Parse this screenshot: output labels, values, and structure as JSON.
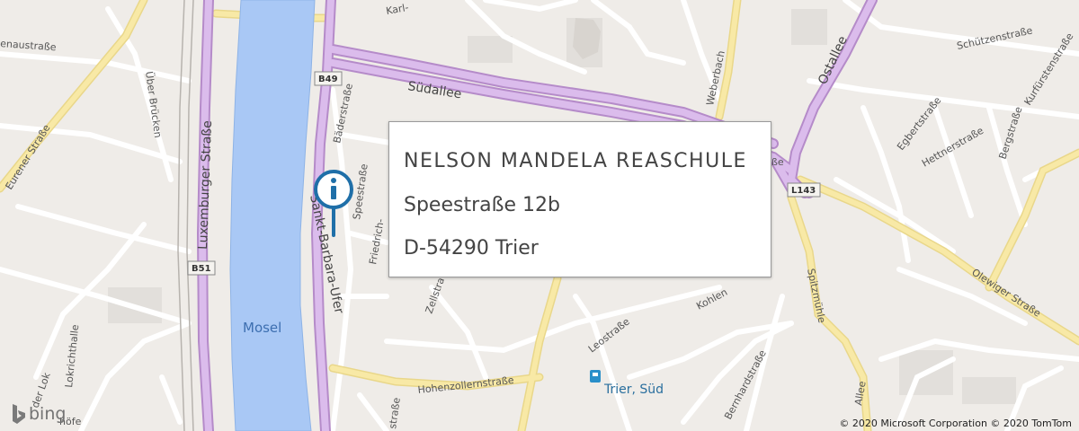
{
  "map": {
    "river_label": "Mosel",
    "street_labels": {
      "suedallee": "Südallee",
      "ostallee": "Ostallee",
      "luxemburger": "Luxemburger Straße",
      "sankt_barbara": "Sankt-Barbara-Ufer",
      "eurener": "Eurener Straße",
      "weberbach": "Weberbach",
      "olewiger": "Olewiger Straße",
      "hohenzollern": "Hohenzollernstraße",
      "leostrasse": "Leostraße",
      "bernhard": "Bernhardstraße",
      "schuetzen": "Schützenstraße",
      "egbert": "Egbertstraße",
      "hettner": "Hettnerstraße",
      "berg": "Bergstraße",
      "kurfuersten": "Kurfürstenstraße",
      "baeder": "Bäderstraße",
      "speestrasse": "Speestraße",
      "friedrich": "Friedrich-",
      "zell": "Zellstra",
      "spitzmuehle": "Spitzmühle",
      "kohlen": "Kohlen",
      "uber_bruecken": "Über Brücken",
      "lokrichthalle": "Lokrichthalle",
      "der_lok": "der Lok",
      "hoefe": "höfe",
      "enaustrasse": "enaustraße",
      "karl": "Karl-",
      "allee": "Allee",
      "strasse_frag": "straße",
      "be_frag": "ße"
    },
    "shields": {
      "b49": "B49",
      "b51": "B51",
      "l143": "L143"
    },
    "station_label": "Trier, Süd",
    "pin_icon": "info-pin-icon",
    "colors": {
      "land": "#efece8",
      "water": "#a9c8f5",
      "highway": "#d9b4e8",
      "highway_edge": "#b58bc9",
      "major_road": "#f7e59b",
      "minor_road": "#ffffff",
      "pin": "#1f6fa8"
    }
  },
  "infobox": {
    "name": "NELSON MANDELA REASCHULE",
    "street": "Speestraße 12b",
    "city": "D-54290 Trier"
  },
  "attribution": {
    "brand": "bing",
    "copyright": "© 2020 Microsoft Corporation © 2020 TomTom"
  }
}
